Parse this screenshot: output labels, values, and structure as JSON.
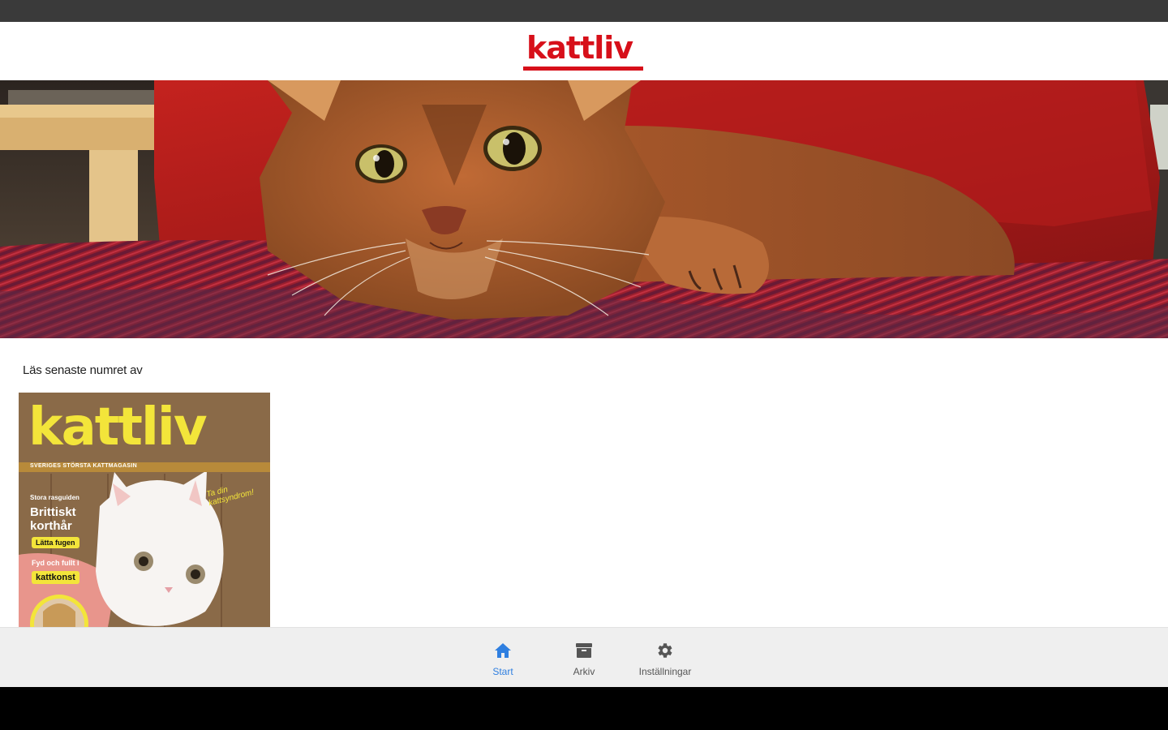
{
  "header": {
    "logo_text": "kattliv",
    "brand_color": "#d7101a"
  },
  "hero": {
    "alt": "Abyssinian cat lying on a red blanket"
  },
  "latest_issue": {
    "label": "Läs senaste numret av",
    "cover": {
      "title": "kattliv",
      "tagline": "SVERIGES STÖRSTA KATTMAGASIN",
      "kicker": "Stora rasguiden",
      "headline": "Brittiskt korthår",
      "pill_1": "Lätta fugen",
      "small_text": "Fyd och fullt i",
      "pill_2": "kattkonst",
      "script": "Ta din kattsyndrom!"
    }
  },
  "bottom_nav": {
    "accent_color": "#2f7fe0",
    "items": [
      {
        "label": "Start",
        "icon": "home-icon",
        "active": true
      },
      {
        "label": "Arkiv",
        "icon": "archive-icon",
        "active": false
      },
      {
        "label": "Inställningar",
        "icon": "gear-icon",
        "active": false
      }
    ]
  }
}
